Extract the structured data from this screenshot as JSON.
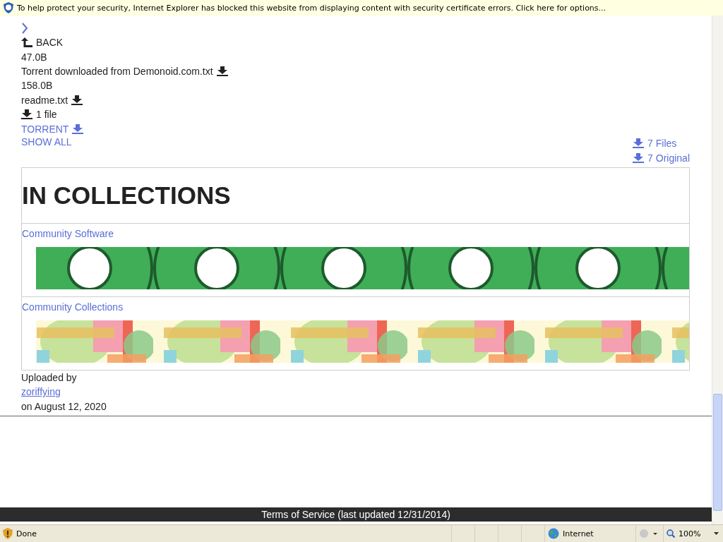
{
  "infobar": {
    "message": "To help protect your security, Internet Explorer has blocked this website from displaying content with security certificate errors. Click here for options..."
  },
  "back_link": "BACK",
  "files": [
    {
      "size": "47.0B",
      "name": "Torrent downloaded from Demonoid.com.txt"
    },
    {
      "size": "158.0B",
      "name": "readme.txt"
    }
  ],
  "download_count": "1 file",
  "torrent_link": "TORRENT",
  "show_all": "SHOW ALL",
  "download_options": [
    "7 Files",
    "7 Original"
  ],
  "collections": {
    "title": "IN COLLECTIONS",
    "items": [
      {
        "name": "Community Software"
      },
      {
        "name": "Community Collections"
      }
    ]
  },
  "uploader": {
    "label": "Uploaded by",
    "name": "zoriffying",
    "date": "on August 12, 2020"
  },
  "footer": "Terms of Service (last updated 12/31/2014)",
  "status_bar": {
    "status": "Done",
    "zone": "Internet",
    "zoom": "100%"
  }
}
